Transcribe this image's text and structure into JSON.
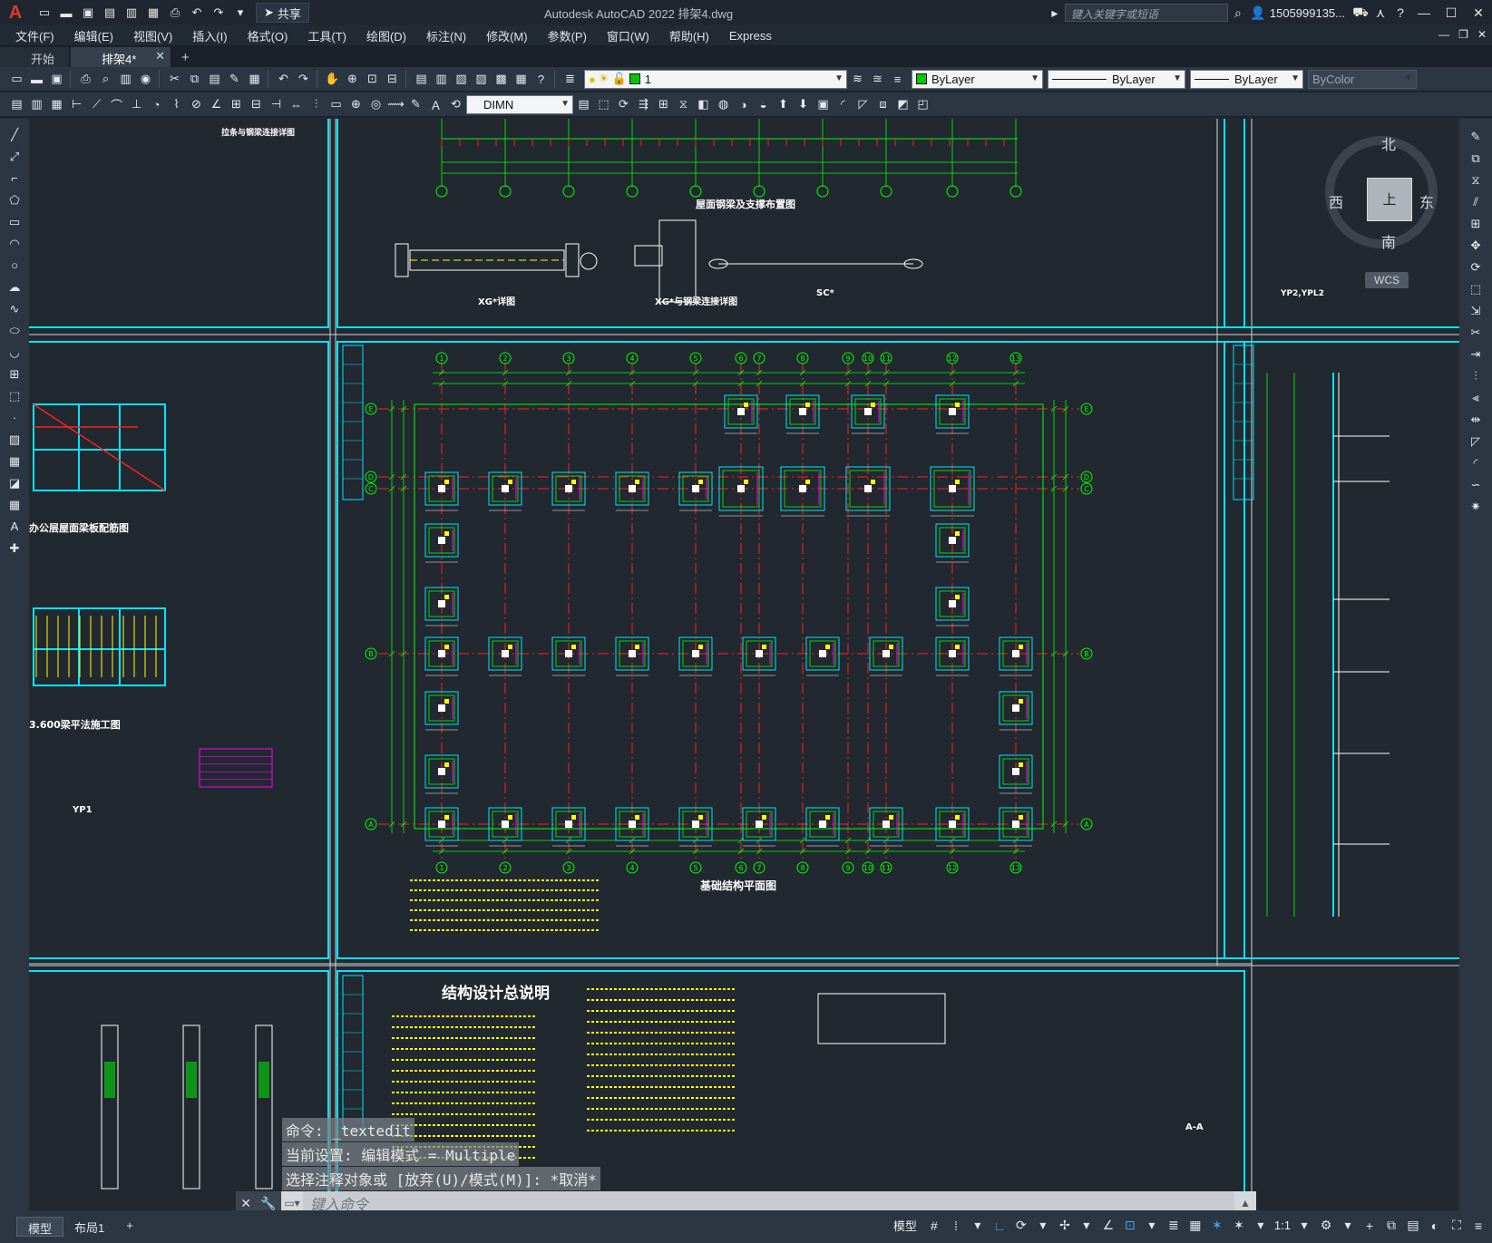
{
  "app": {
    "logo": "A",
    "window_title": "Autodesk AutoCAD 2022    排架4.dwg",
    "share_label": "共享",
    "search_placeholder": "键入关键字或短语",
    "user_name": "1505999135...",
    "qat_icons": [
      "new-icon",
      "open-icon",
      "save-icon",
      "saveas-icon",
      "open-web-icon",
      "save-web-icon",
      "plot-icon",
      "undo-icon",
      "redo-icon",
      "dropdown-icon"
    ]
  },
  "menu": [
    "文件(F)",
    "编辑(E)",
    "视图(V)",
    "插入(I)",
    "格式(O)",
    "工具(T)",
    "绘图(D)",
    "标注(N)",
    "修改(M)",
    "参数(P)",
    "窗口(W)",
    "帮助(H)",
    "Express"
  ],
  "tabs": {
    "start": "开始",
    "active": "排架4*"
  },
  "properties": {
    "layer_value": "1",
    "color_value": "ByLayer",
    "linetype_value": "ByLayer",
    "lineweight_value": "ByLayer",
    "plotstyle_value": "ByColor",
    "dimstyle_value": "DIMN",
    "layer_color": "#00c800"
  },
  "viewcube": {
    "north": "北",
    "south": "南",
    "west": "西",
    "east": "东",
    "face": "上",
    "wcs": "WCS"
  },
  "drawing": {
    "titles": {
      "roof_bracing": "屋面钢梁及支撑布置图",
      "xg_detail": "XG*详图",
      "xg_joint": "XG*与钢梁连接详图",
      "sc_detail": "SC*",
      "foundation_plan": "基础结构平面图",
      "structure_notes": "结构设计总说明",
      "office_roof_plan": "办公层屋面梁板配筋图",
      "beam_plan": "3.600梁平法施工图",
      "tie_bar": "拉条与钢梁连接详图",
      "yp_label": "YP2,YPL2",
      "yp1": "YP1",
      "aa": "A-A"
    },
    "axis_numbers": [
      "1",
      "2",
      "3",
      "4",
      "5",
      "6",
      "7",
      "8",
      "9",
      "10",
      "11",
      "12",
      "13"
    ],
    "axis_letters": [
      "A",
      "B",
      "C",
      "D",
      "E"
    ]
  },
  "command": {
    "line1": "命令:  _textedit",
    "line2": "当前设置: 编辑模式 = Multiple",
    "line3": "选择注释对象或 [放弃(U)/模式(M)]: *取消*",
    "placeholder": "键入命令"
  },
  "status": {
    "layout_model": "模型",
    "layout_1": "布局1",
    "add": "+",
    "model_label": "模型",
    "scale": "1:1"
  },
  "colors": {
    "cyan": "#00e5ff",
    "green": "#00ff00",
    "red": "#ff2020",
    "yellow": "#ffff00",
    "magenta": "#ff00ff",
    "white": "#ffffff"
  }
}
